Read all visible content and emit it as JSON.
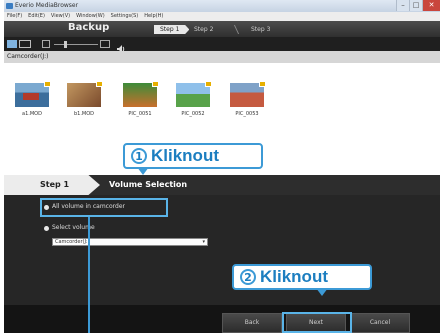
{
  "window": {
    "title": "Everio MediaBrowser",
    "controls": [
      "–",
      "□",
      "✕"
    ]
  },
  "menu": {
    "items": [
      "File(F)",
      "Edit(E)",
      "View(V)",
      "Window(W)",
      "Settings(S)",
      "Help(H)"
    ]
  },
  "header": {
    "title": "Backup",
    "steps": [
      "Step 1",
      "Step 2",
      "Step 3"
    ]
  },
  "camcorder": {
    "label": "Camcorder(J:)",
    "thumbnails": [
      {
        "caption": "a1.MOD",
        "colors": [
          "#3c6e9c",
          "#b33a2a"
        ]
      },
      {
        "caption": "b1.MOD",
        "colors": [
          "#7a4a2c",
          "#c29760"
        ]
      },
      {
        "caption": "PIC_0051",
        "colors": [
          "#3d8c3a",
          "#c86f2c"
        ]
      },
      {
        "caption": "PIC_0052",
        "colors": [
          "#4d8ac2",
          "#58a24a"
        ]
      },
      {
        "caption": "PIC_0053",
        "colors": [
          "#c55a40",
          "#7fa2c8"
        ]
      }
    ]
  },
  "wizard": {
    "step_label": "Step 1",
    "step_title": "Volume Selection",
    "option_all": "All volume in camcorder",
    "option_select": "Select volume",
    "select_value": "Camcorder(J:)"
  },
  "buttons": {
    "back": "Back",
    "next": "Next",
    "cancel": "Cancel"
  },
  "annotations": {
    "callout1": {
      "number": "1",
      "text": "Kliknout"
    },
    "callout2": {
      "number": "2",
      "text": "Kliknout"
    },
    "color": "#3c9ad6"
  }
}
